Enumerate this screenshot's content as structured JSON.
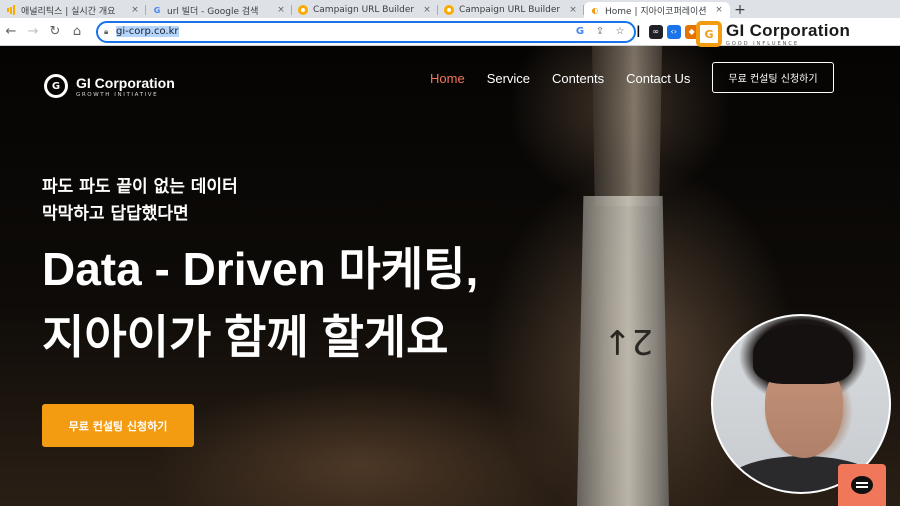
{
  "browser": {
    "tabs": [
      {
        "title": "애널리틱스 | 실시간 개요",
        "icon": "analytics-icon",
        "active": false
      },
      {
        "title": "url 빌더 - Google 검색",
        "icon": "google-icon",
        "active": false
      },
      {
        "title": "Campaign URL Builder",
        "icon": "ga-icon",
        "active": false
      },
      {
        "title": "Campaign URL Builder",
        "icon": "ga-icon",
        "active": false
      },
      {
        "title": "Home | 지아이코퍼레이션",
        "icon": "gi-icon",
        "active": true
      }
    ],
    "new_tab_label": "+",
    "close_glyph": "×",
    "url": "gi-corp.co.kr"
  },
  "site": {
    "logo_name": "GI Corporation",
    "logo_sub": "GROWTH INITIATIVE",
    "nav": [
      {
        "label": "Home",
        "active": true
      },
      {
        "label": "Service",
        "active": false
      },
      {
        "label": "Contents",
        "active": false
      },
      {
        "label": "Contact Us",
        "active": false
      }
    ],
    "cta_top": "무료 컨설팅 신청하기",
    "pre_line1": "파도 파도 끝이 없는 데이터",
    "pre_line2": "막막하고 답답했다면",
    "headline1": "Data - Driven 마케팅,",
    "headline2": "지아이가 함께 할게요",
    "cta_main": "무료 컨설팅 신청하기"
  },
  "watermark": {
    "name": "GI Corporation",
    "sub": "GOOD INFLUENCE"
  },
  "colors": {
    "accent_orange": "#f39c12",
    "nav_active": "#f0775a",
    "omnibox_focus": "#1a73e8"
  }
}
